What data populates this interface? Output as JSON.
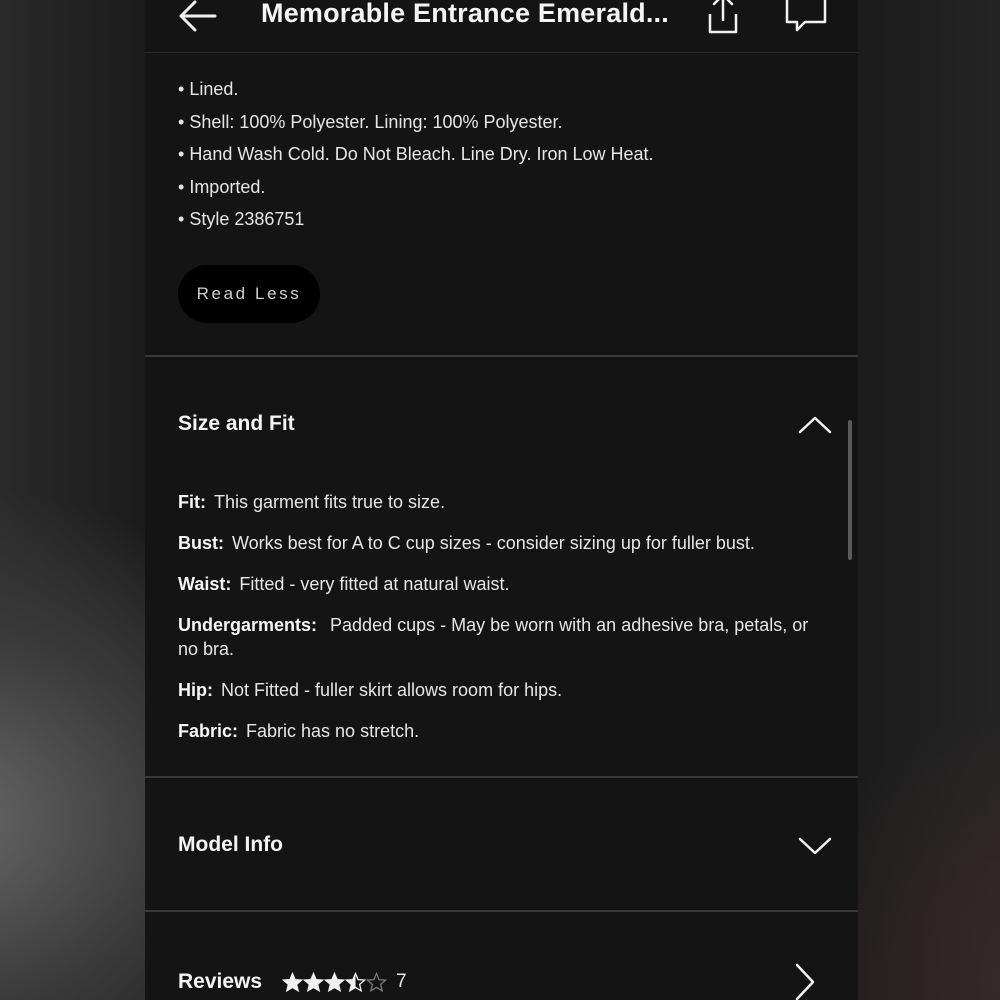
{
  "header": {
    "title": "Memorable Entrance Emerald..."
  },
  "icons": {
    "back": "arrow-left-icon",
    "share": "share-icon",
    "chat": "chat-bubble-icon",
    "collapse": "chevron-up-icon",
    "expand": "chevron-down-icon",
    "open": "chevron-right-icon"
  },
  "description": {
    "bullets": [
      "Lined.",
      "Shell: 100% Polyester. Lining: 100% Polyester.",
      "Hand Wash Cold. Do Not Bleach. Line Dry. Iron Low Heat.",
      "Imported.",
      "Style 2386751"
    ],
    "read_less_label": "Read Less"
  },
  "size_fit": {
    "title": "Size and Fit",
    "rows": [
      {
        "key": "Fit:",
        "value": "This garment fits true to size."
      },
      {
        "key": "Bust:",
        "value": "Works best for A to C cup sizes - consider sizing up for fuller bust."
      },
      {
        "key": "Waist:",
        "value": "Fitted - very fitted at natural waist."
      },
      {
        "key": "Undergarments:",
        "value": " Padded cups - May be worn with an adhesive bra, petals, or no bra."
      },
      {
        "key": "Hip:",
        "value": "Not Fitted - fuller skirt allows room for hips."
      },
      {
        "key": "Fabric:",
        "value": "Fabric has no stretch."
      }
    ]
  },
  "model_info": {
    "title": "Model Info"
  },
  "reviews": {
    "title": "Reviews",
    "rating": 3.5,
    "max_rating": 5,
    "count": "7"
  },
  "colors": {
    "panel": "#151415",
    "text": "#f2f2f2",
    "divider": "#3a3a3a",
    "button_bg": "#000000"
  }
}
